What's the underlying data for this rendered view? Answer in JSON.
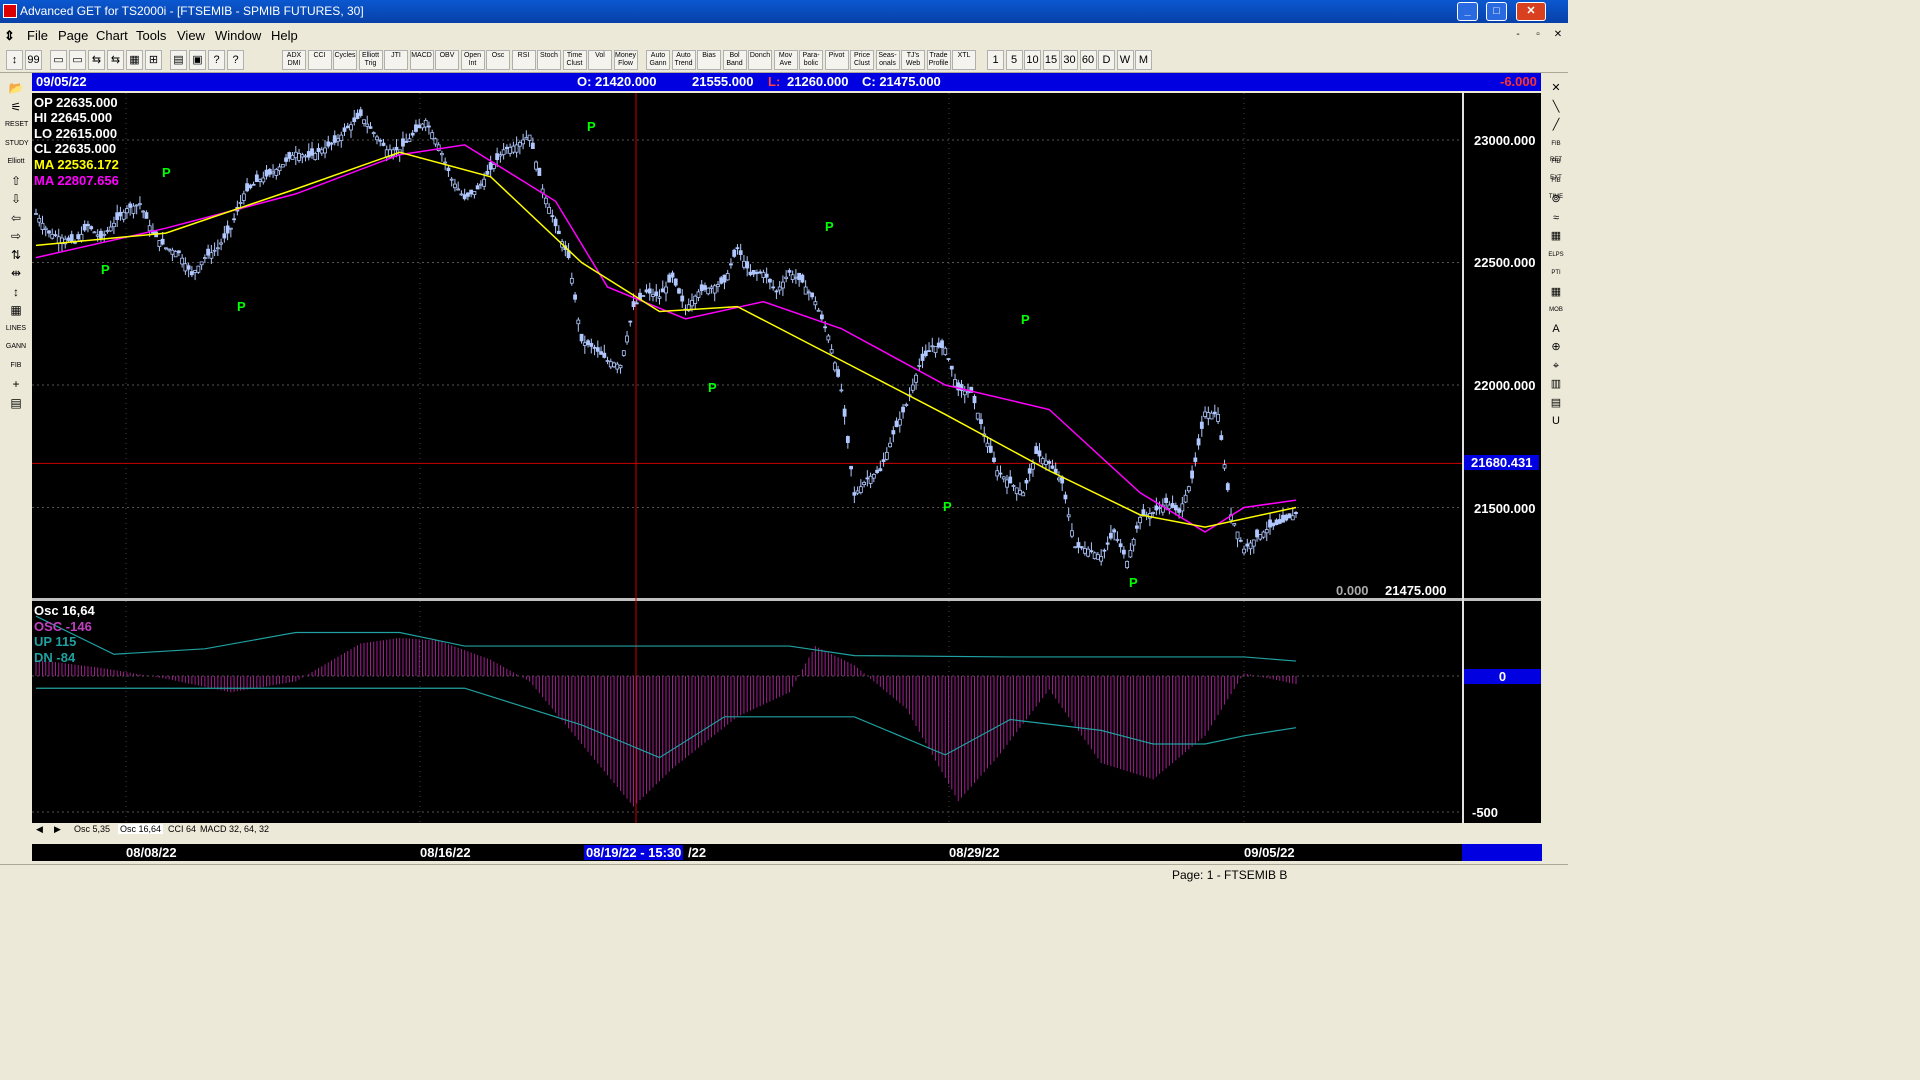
{
  "window": {
    "title": "Advanced GET for TS2000i - [FTSEMIB - SPMIB FUTURES, 30]",
    "min": "_",
    "max": "□",
    "close": "✕"
  },
  "menu": {
    "items": [
      "File",
      "Page",
      "Chart",
      "Tools",
      "View",
      "Window",
      "Help"
    ],
    "mdi": [
      "-",
      "▫",
      "✕"
    ]
  },
  "toolbar": {
    "icons": [
      "↕",
      "99",
      "▭",
      "▭",
      "⇆",
      "⇆",
      "▦",
      "⊞",
      "▤",
      "▣",
      "?",
      "?"
    ],
    "studies": [
      "ADX DMI",
      "CCI",
      "Cycles",
      "Elliott Trig",
      "JTI",
      "MACD",
      "OBV",
      "Open Int",
      "Osc",
      "RSI",
      "Stoch",
      "Time Clust",
      "Vol",
      "Money Flow"
    ],
    "tools": [
      "Auto Gann",
      "Auto Trend",
      "Bias",
      "Bol Band",
      "Donch",
      "Mov Ave",
      "Para- bolic",
      "Pivot",
      "Price Clust",
      "Seas- onals",
      "TJ's Web",
      "Trade Profile",
      "XTL"
    ],
    "intervals": [
      "1",
      "5",
      "10",
      "15",
      "30",
      "60",
      "D",
      "W",
      "M"
    ]
  },
  "left_tools": [
    "📂",
    "⚟",
    "RESET",
    "STUDY",
    "Elliott",
    "⇧",
    "⇩",
    "⇦",
    "⇨",
    "⇅",
    "⇹",
    "↕",
    "▦",
    "LINES",
    "GANN",
    "FIB",
    "+",
    "▤"
  ],
  "right_tools": [
    "✕",
    "╲",
    "╱",
    "FIB RET",
    "FIB EXT",
    "FIB TIME",
    "⊚",
    "≈",
    "▦",
    "ELPS",
    "PTI",
    "▦",
    "MOB",
    "A",
    "⊕",
    "⌖",
    "▥",
    "▤",
    "U"
  ],
  "info": {
    "date": "09/05/22",
    "open": "O: 21420.000",
    "high": "21555.000",
    "low_label": "L:",
    "low": "21260.000",
    "close": "C: 21475.000",
    "change": "-6.000"
  },
  "legend": {
    "op": "OP  22635.000",
    "hi": "HI   22645.000",
    "lo": "LO  22615.000",
    "cl": "CL  22635.000",
    "ma1": "MA  22536.172",
    "ma2": "MA  22807.656"
  },
  "price_axis": {
    "labels": [
      "23000.000",
      "22500.000",
      "22000.000",
      "21500.000"
    ],
    "crosshair": "21680.431",
    "bottom_left": "0.000",
    "bottom_right": "21475.000"
  },
  "osc": {
    "title": "Osc 16,64",
    "osc": "OSC -146",
    "up": "UP   115",
    "dn": "DN   -84",
    "zero": "0",
    "low": "-500"
  },
  "pivots": [
    "P",
    "P",
    "P",
    "P",
    "P",
    "P",
    "P",
    "P",
    "P"
  ],
  "tabs": [
    "◀",
    "▶",
    "Osc 5,35",
    "Osc 16,64",
    "CCI 64",
    "MACD 32, 64, 32"
  ],
  "dates": {
    "d1": "08/08/22",
    "d2": "08/16/22",
    "d3": "08/19/22 - 15:30",
    "d3b": "/22",
    "d4": "08/29/22",
    "d5": "09/05/22"
  },
  "status": "Page: 1 - FTSEMIB B",
  "colors": {
    "ma1": "#ffff00",
    "ma2": "#ff00ff",
    "osc": "#a0208f",
    "up_dn": "#20a0a0",
    "candle": "#b0c8ff",
    "pivot": "#00ff00",
    "crosshair": "#cc0000",
    "infobar": "#0000e0"
  },
  "chart_data": {
    "type": "candlestick",
    "title": "FTSEMIB - SPMIB FUTURES, 30",
    "x_ticks": [
      "08/08/22",
      "08/16/22",
      "08/19/22",
      "08/29/22",
      "09/05/22"
    ],
    "ylim": [
      21200,
      23150
    ],
    "y_ticks": [
      23000,
      22500,
      22000,
      21500
    ],
    "close_path": [
      [
        0,
        22700
      ],
      [
        2,
        22620
      ],
      [
        4,
        22600
      ],
      [
        6,
        22580
      ],
      [
        8,
        22650
      ],
      [
        10,
        22600
      ],
      [
        12,
        22660
      ],
      [
        14,
        22720
      ],
      [
        16,
        22740
      ],
      [
        18,
        22620
      ],
      [
        20,
        22560
      ],
      [
        22,
        22540
      ],
      [
        24,
        22450
      ],
      [
        26,
        22520
      ],
      [
        28,
        22560
      ],
      [
        30,
        22640
      ],
      [
        32,
        22780
      ],
      [
        34,
        22830
      ],
      [
        36,
        22860
      ],
      [
        38,
        22900
      ],
      [
        40,
        22950
      ],
      [
        42,
        22930
      ],
      [
        44,
        22960
      ],
      [
        46,
        22990
      ],
      [
        48,
        23050
      ],
      [
        50,
        23100
      ],
      [
        52,
        23030
      ],
      [
        54,
        22960
      ],
      [
        56,
        22960
      ],
      [
        58,
        23020
      ],
      [
        60,
        23080
      ],
      [
        62,
        22980
      ],
      [
        64,
        22840
      ],
      [
        66,
        22760
      ],
      [
        68,
        22800
      ],
      [
        70,
        22880
      ],
      [
        72,
        22960
      ],
      [
        74,
        22980
      ],
      [
        76,
        23020
      ],
      [
        78,
        22800
      ],
      [
        80,
        22650
      ],
      [
        82,
        22520
      ],
      [
        84,
        22180
      ],
      [
        86,
        22150
      ],
      [
        88,
        22100
      ],
      [
        90,
        22080
      ],
      [
        92,
        22320
      ],
      [
        94,
        22380
      ],
      [
        96,
        22360
      ],
      [
        98,
        22440
      ],
      [
        100,
        22310
      ],
      [
        102,
        22380
      ],
      [
        104,
        22400
      ],
      [
        106,
        22420
      ],
      [
        108,
        22560
      ],
      [
        110,
        22450
      ],
      [
        112,
        22460
      ],
      [
        114,
        22380
      ],
      [
        116,
        22460
      ],
      [
        118,
        22420
      ],
      [
        120,
        22340
      ],
      [
        122,
        22200
      ],
      [
        124,
        21980
      ],
      [
        126,
        21550
      ],
      [
        128,
        21620
      ],
      [
        130,
        21650
      ],
      [
        132,
        21800
      ],
      [
        134,
        21920
      ],
      [
        136,
        22080
      ],
      [
        138,
        22160
      ],
      [
        140,
        22150
      ],
      [
        142,
        21980
      ],
      [
        144,
        21970
      ],
      [
        146,
        21800
      ],
      [
        148,
        21650
      ],
      [
        150,
        21600
      ],
      [
        152,
        21560
      ],
      [
        154,
        21720
      ],
      [
        156,
        21680
      ],
      [
        158,
        21600
      ],
      [
        160,
        21340
      ],
      [
        162,
        21330
      ],
      [
        164,
        21300
      ],
      [
        166,
        21400
      ],
      [
        168,
        21280
      ],
      [
        170,
        21460
      ],
      [
        172,
        21480
      ],
      [
        174,
        21520
      ],
      [
        176,
        21480
      ],
      [
        178,
        21620
      ],
      [
        180,
        21890
      ],
      [
        182,
        21880
      ],
      [
        184,
        21470
      ],
      [
        186,
        21330
      ],
      [
        188,
        21380
      ],
      [
        190,
        21420
      ],
      [
        192,
        21440
      ],
      [
        194,
        21475
      ]
    ],
    "ma_fast": [
      [
        0,
        22570
      ],
      [
        20,
        22620
      ],
      [
        40,
        22800
      ],
      [
        56,
        22950
      ],
      [
        70,
        22850
      ],
      [
        84,
        22500
      ],
      [
        96,
        22300
      ],
      [
        108,
        22320
      ],
      [
        124,
        22100
      ],
      [
        140,
        21880
      ],
      [
        156,
        21650
      ],
      [
        170,
        21470
      ],
      [
        180,
        21420
      ],
      [
        194,
        21500
      ]
    ],
    "ma_slow": [
      [
        0,
        22520
      ],
      [
        20,
        22640
      ],
      [
        40,
        22780
      ],
      [
        56,
        22940
      ],
      [
        66,
        22980
      ],
      [
        80,
        22750
      ],
      [
        88,
        22400
      ],
      [
        100,
        22270
      ],
      [
        112,
        22340
      ],
      [
        124,
        22230
      ],
      [
        140,
        22000
      ],
      [
        156,
        21900
      ],
      [
        170,
        21560
      ],
      [
        180,
        21400
      ],
      [
        186,
        21500
      ],
      [
        194,
        21530
      ]
    ],
    "osc_series": [
      [
        0,
        60
      ],
      [
        10,
        30
      ],
      [
        20,
        -10
      ],
      [
        30,
        -60
      ],
      [
        40,
        -20
      ],
      [
        50,
        120
      ],
      [
        56,
        140
      ],
      [
        62,
        130
      ],
      [
        70,
        60
      ],
      [
        76,
        -20
      ],
      [
        84,
        -250
      ],
      [
        92,
        -480
      ],
      [
        98,
        -340
      ],
      [
        108,
        -150
      ],
      [
        116,
        -60
      ],
      [
        120,
        110
      ],
      [
        126,
        40
      ],
      [
        134,
        -120
      ],
      [
        142,
        -460
      ],
      [
        148,
        -300
      ],
      [
        156,
        -50
      ],
      [
        164,
        -320
      ],
      [
        172,
        -380
      ],
      [
        180,
        -220
      ],
      [
        186,
        10
      ],
      [
        194,
        -30
      ]
    ],
    "up_series": [
      [
        0,
        220
      ],
      [
        12,
        80
      ],
      [
        26,
        100
      ],
      [
        40,
        160
      ],
      [
        56,
        160
      ],
      [
        66,
        110
      ],
      [
        84,
        110
      ],
      [
        116,
        110
      ],
      [
        126,
        75
      ],
      [
        150,
        70
      ],
      [
        186,
        70
      ],
      [
        194,
        55
      ]
    ],
    "dn_series": [
      [
        0,
        -45
      ],
      [
        12,
        -45
      ],
      [
        26,
        -45
      ],
      [
        40,
        -45
      ],
      [
        66,
        -45
      ],
      [
        84,
        -180
      ],
      [
        96,
        -300
      ],
      [
        106,
        -150
      ],
      [
        116,
        -150
      ],
      [
        126,
        -150
      ],
      [
        140,
        -290
      ],
      [
        150,
        -160
      ],
      [
        164,
        -200
      ],
      [
        172,
        -250
      ],
      [
        180,
        -250
      ],
      [
        186,
        -220
      ],
      [
        194,
        -190
      ]
    ]
  }
}
